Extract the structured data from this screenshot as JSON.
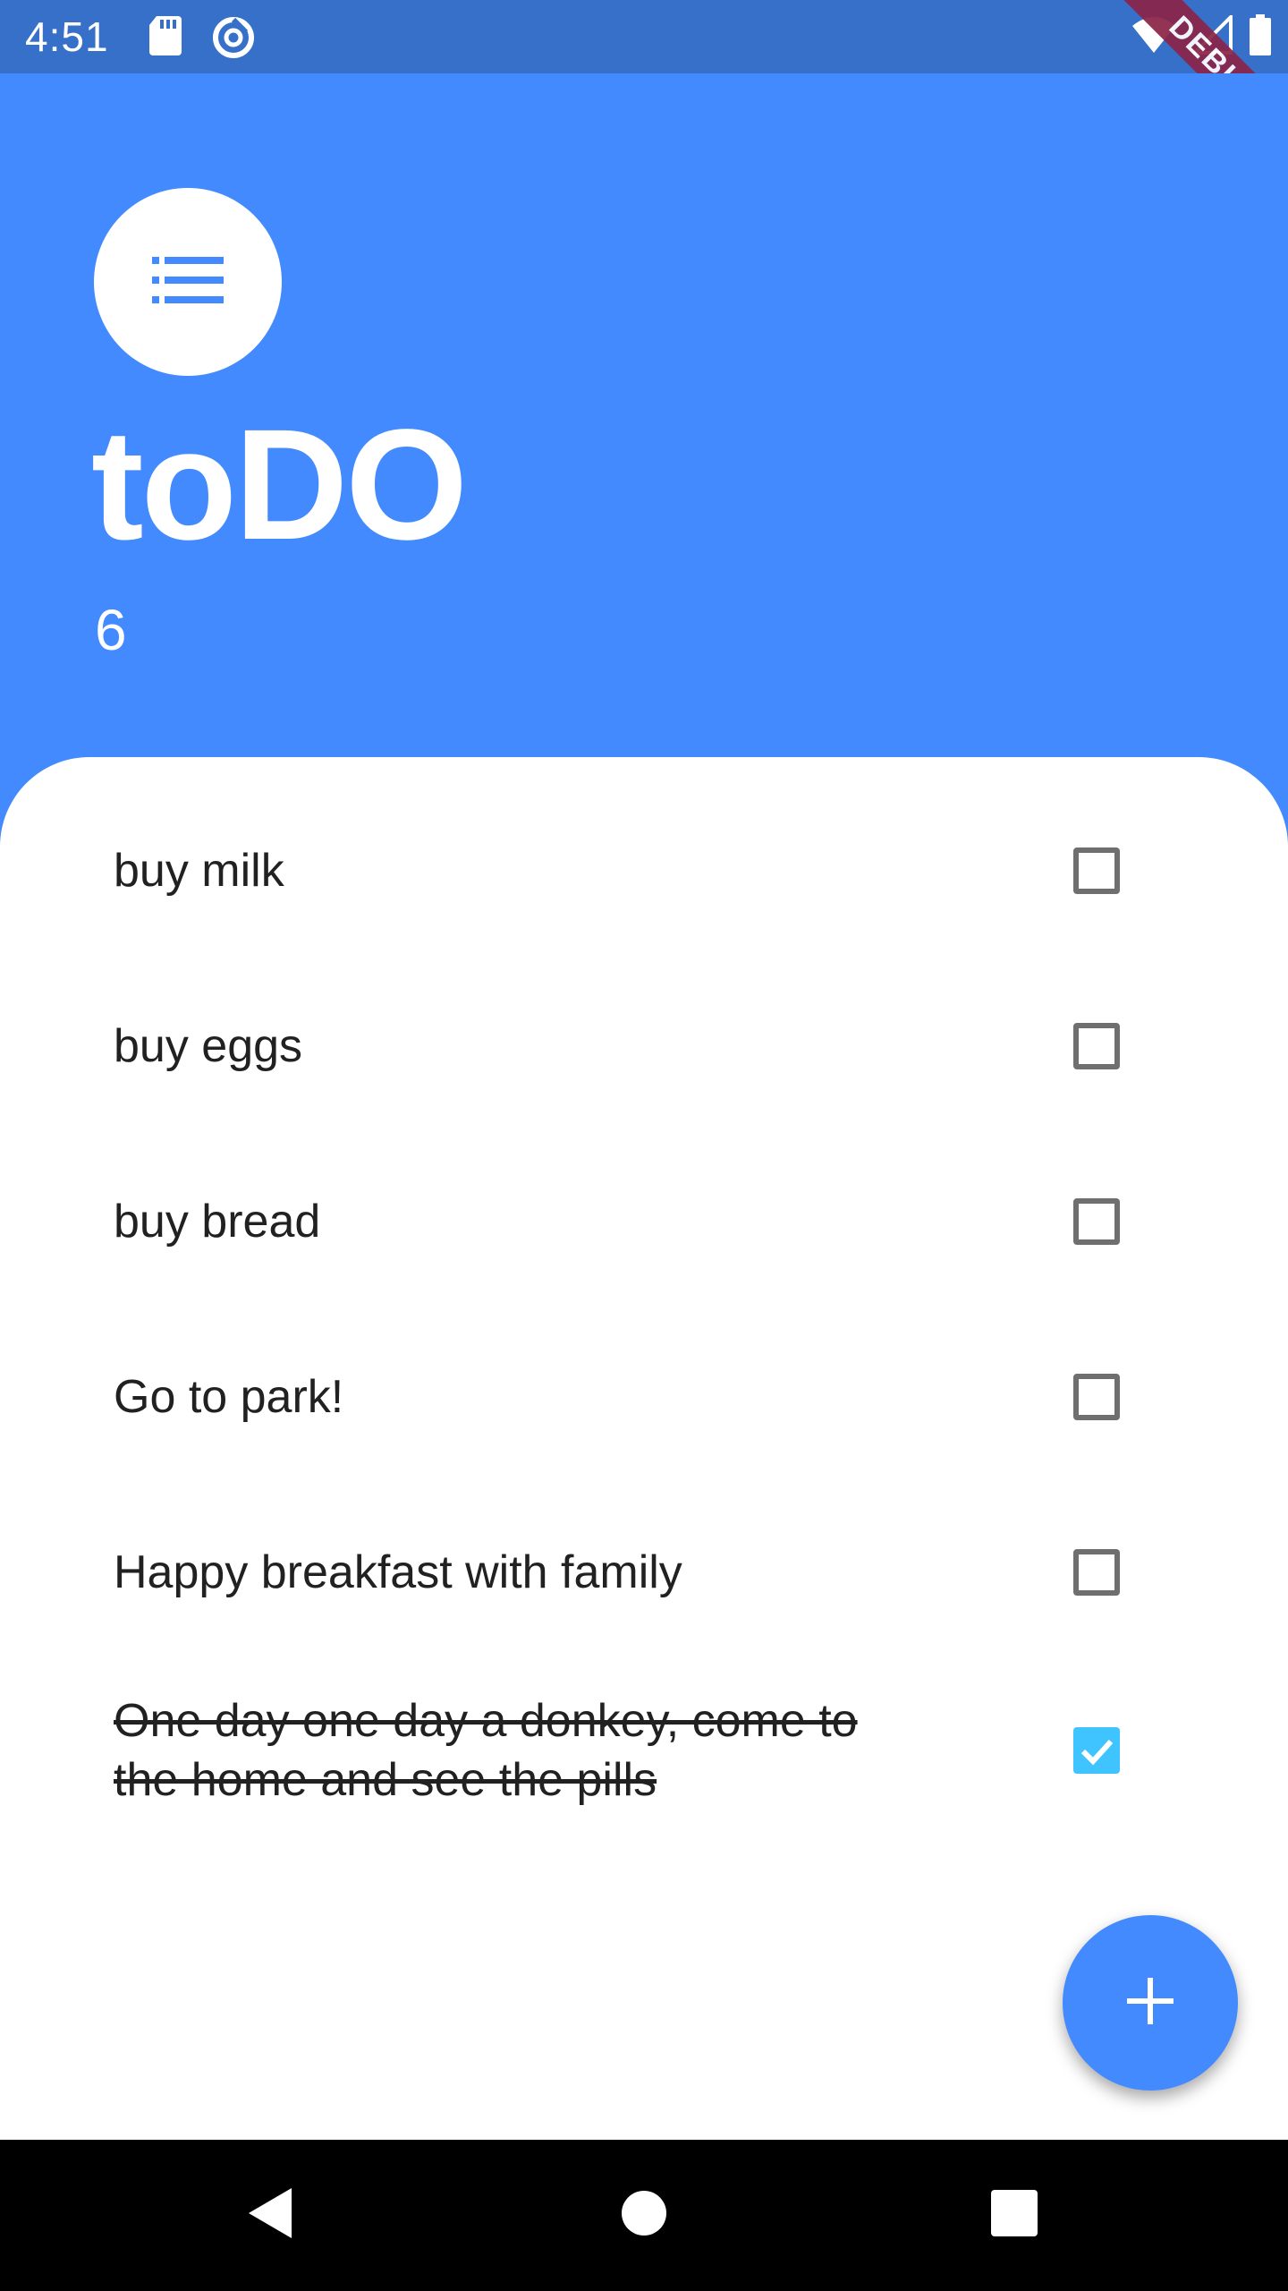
{
  "status_bar": {
    "time": "4:51",
    "left_icons": [
      "sd-card-icon",
      "data-saver-icon"
    ],
    "right_icons": [
      "wifi-icon",
      "cell-signal-icon",
      "battery-icon"
    ],
    "debug_label": "DEBUG"
  },
  "header": {
    "logo_icon": "list-icon",
    "title": "toDO",
    "count": "6"
  },
  "todos": [
    {
      "text": "buy milk",
      "done": false
    },
    {
      "text": "buy eggs",
      "done": false
    },
    {
      "text": "buy bread",
      "done": false
    },
    {
      "text": "Go to park!",
      "done": false
    },
    {
      "text": "Happy breakfast with family",
      "done": false
    },
    {
      "text": "One day one day a donkey, come to the home and see the pills",
      "done": true
    }
  ],
  "fab": {
    "icon": "plus-icon"
  },
  "nav_bar": {
    "buttons": [
      "back-icon",
      "home-icon",
      "recents-icon"
    ]
  },
  "colors": {
    "primary": "#448aff",
    "status_bar": "#3670c9",
    "checkbox_checked": "#40c4ff",
    "debug_ribbon": "#8b2347"
  }
}
